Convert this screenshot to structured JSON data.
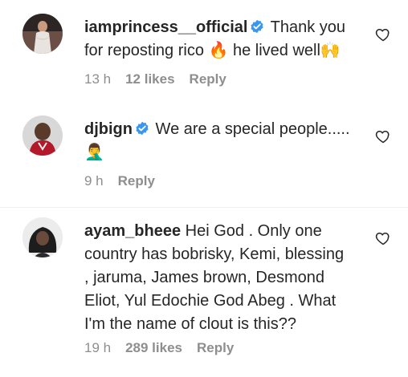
{
  "comments": [
    {
      "username": "iamprincess__official",
      "verified": true,
      "text_line1": "Thank you",
      "text_line2": "for reposting rico 🔥 he lived well🙌",
      "time": "13 h",
      "likes": "12 likes",
      "reply": "Reply",
      "like_icon": "heart-outline-icon"
    },
    {
      "username": "djbign",
      "verified": true,
      "text_line1": "We are a special people.....",
      "text_line2": "🤦‍♂️",
      "time": "9 h",
      "likes": "",
      "reply": "Reply",
      "like_icon": "heart-outline-icon"
    },
    {
      "username": "ayam_bheee",
      "verified": false,
      "text_line1": "Hei God . Only one",
      "text_line2": "country has bobrisky, Kemi, blessing",
      "text_line3": ", jaruma, James brown, Desmond",
      "text_line4": "Eliot, Yul Edochie God Abeg . What",
      "text_line5": "I'm the name of clout is this??",
      "time": "19 h",
      "likes": "289 likes",
      "reply": "Reply",
      "like_icon": "heart-outline-icon"
    }
  ],
  "colors": {
    "verified_blue": "#3897f0",
    "meta_gray": "#8e8e8e",
    "text": "#262626"
  }
}
